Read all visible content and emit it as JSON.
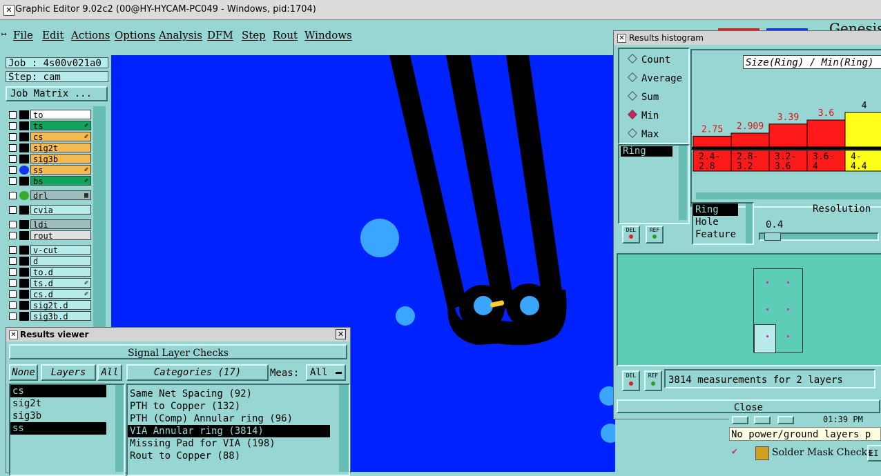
{
  "window": {
    "title": "Graphic Editor 9.02c2 (00@HY-HYCAM-PC049 - Windows, pid:1704)",
    "close_glyph": "✕"
  },
  "menu": [
    "File",
    "Edit",
    "Actions",
    "Options",
    "Analysis",
    "DFM",
    "Step",
    "Rout",
    "Windows"
  ],
  "logo_text": "Genesis",
  "job_panel": {
    "job": "Job : 4s00v021a0",
    "step": "Step: cam",
    "job_matrix": "Job Matrix ..."
  },
  "layers": [
    {
      "name": "to",
      "color": "#ffffff",
      "dot": "black",
      "lock": ""
    },
    {
      "name": "ts",
      "color": "#12a35e",
      "dot": "black",
      "lock": "✐"
    },
    {
      "name": "cs",
      "color": "#f6b94f",
      "dot": "black",
      "lock": "✐"
    },
    {
      "name": "sig2t",
      "color": "#f6b94f",
      "dot": "black",
      "lock": ""
    },
    {
      "name": "sig3b",
      "color": "#f6b94f",
      "dot": "black",
      "lock": ""
    },
    {
      "name": "ss",
      "color": "#f6b94f",
      "dot": "blue",
      "lock": "✐"
    },
    {
      "name": "bs",
      "color": "#12a35e",
      "dot": "black",
      "lock": "✐"
    },
    {
      "name": "drl",
      "color": "#9ebdbd",
      "dot": "green",
      "lock": "▦"
    },
    {
      "name": "cvia",
      "color": "#b8ecea",
      "dot": "black",
      "lock": ""
    },
    {
      "name": "ldi",
      "color": "#9ebdbd",
      "dot": "black",
      "lock": ""
    },
    {
      "name": "rout",
      "color": "#e0e0e0",
      "dot": "black",
      "lock": ""
    },
    {
      "name": "v-cut",
      "color": "#b8ecea",
      "dot": "black",
      "lock": ""
    },
    {
      "name": "d",
      "color": "#b8ecea",
      "dot": "black",
      "lock": ""
    },
    {
      "name": "to.d",
      "color": "#b8ecea",
      "dot": "black",
      "lock": ""
    },
    {
      "name": "ts.d",
      "color": "#b8ecea",
      "dot": "black",
      "lock": "✐"
    },
    {
      "name": "cs.d",
      "color": "#b8ecea",
      "dot": "black",
      "lock": "✐"
    },
    {
      "name": "sig2t.d",
      "color": "#b8ecea",
      "dot": "black",
      "lock": ""
    },
    {
      "name": "sig3b.d",
      "color": "#b8ecea",
      "dot": "black",
      "lock": ""
    }
  ],
  "histogram": {
    "title": "Results histogram",
    "modes": [
      {
        "label": "Count",
        "selected": false
      },
      {
        "label": "Average",
        "selected": false
      },
      {
        "label": "Sum",
        "selected": false
      },
      {
        "label": "Min",
        "selected": true
      },
      {
        "label": "Max",
        "selected": false
      }
    ],
    "field_list": [
      "Ring"
    ],
    "del_label": "DEL",
    "ref_label": "REF",
    "chart_title": "Size(Ring) / Min(Ring)",
    "measure_list": [
      "Ring",
      "Hole",
      "Feature"
    ],
    "resolution_label": "Resolution",
    "resolution_value": "0.4",
    "status": "3814 measurements for 2 layers",
    "close": "Close"
  },
  "chart_data": {
    "type": "bar",
    "categories": [
      "2.4-\n2.8",
      "2.8-\n3.2",
      "3.2-\n3.6",
      "3.6-\n4",
      "4-\n4.4"
    ],
    "values": [
      2.75,
      2.909,
      3.39,
      3.6,
      4
    ],
    "value_labels": [
      "2.75",
      "2.909",
      "3.39",
      "3.6",
      "4"
    ],
    "colors": [
      "#ff1a1a",
      "#ff1a1a",
      "#ff1a1a",
      "#ff1a1a",
      "#ffff1a"
    ],
    "title": "Size(Ring) / Min(Ring)"
  },
  "results_viewer": {
    "title": "Results viewer",
    "header": "Signal Layer Checks",
    "none_btn": "None",
    "layers_label": "Layers",
    "all_btn": "All",
    "categories_label": "Categories (17)",
    "meas_label": "Meas:",
    "meas_value": "All",
    "layers": [
      {
        "name": "cs",
        "selected": true
      },
      {
        "name": "sig2t",
        "selected": false
      },
      {
        "name": "sig3b",
        "selected": false
      },
      {
        "name": "ss",
        "selected": true
      }
    ],
    "categories": [
      {
        "name": "Same Net Spacing (92)",
        "selected": false
      },
      {
        "name": "PTH to Copper (132)",
        "selected": false
      },
      {
        "name": "PTH (Comp) Annular ring (96)",
        "selected": false
      },
      {
        "name": "VIA Annular ring (3814)",
        "selected": true
      },
      {
        "name": "Missing Pad for VIA (198)",
        "selected": false
      },
      {
        "name": "Rout to Copper (88)",
        "selected": false
      }
    ]
  },
  "lower_right": {
    "time_text": "01:39 PM",
    "note": "No power/ground layers p",
    "check_label": "Solder Mask Checks",
    "check_suffix": "EI"
  }
}
